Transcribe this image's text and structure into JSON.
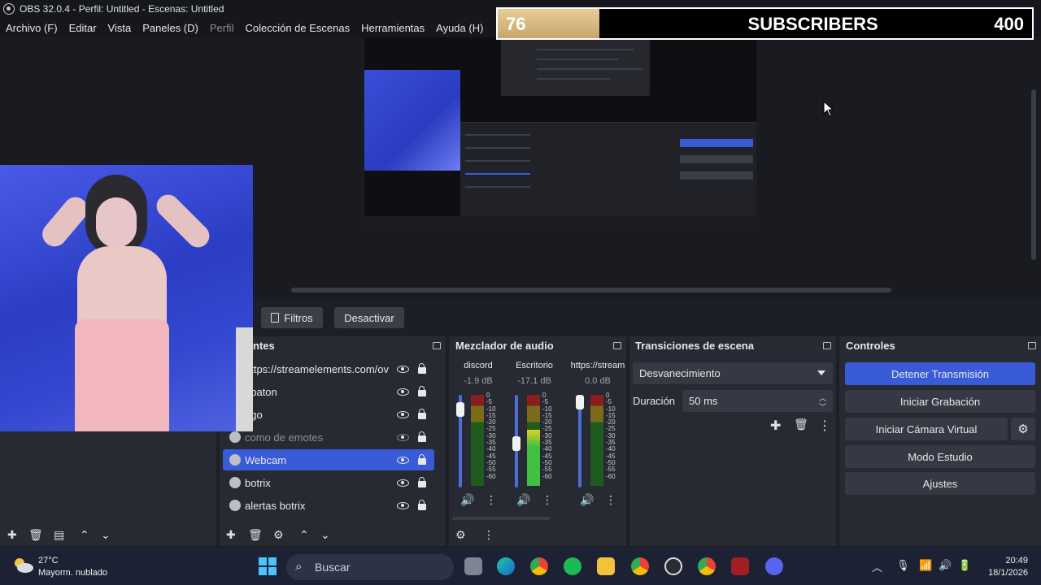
{
  "window": {
    "title": "OBS 32.0.4 - Perfil: Untitled - Escenas: Untitled"
  },
  "menu": [
    "Archivo (F)",
    "Editar",
    "Vista",
    "Paneles (D)",
    "Perfil",
    "Colección de Escenas",
    "Herramientas",
    "Ayuda (H)"
  ],
  "subscriber_goal": {
    "current": "76",
    "label": "SUBSCRIBERS",
    "goal": "400",
    "progress_fraction": 0.19
  },
  "source_toolbar": {
    "filters_label": "Filtros",
    "deactivate_label": "Desactivar"
  },
  "sources": {
    "title": "ntes",
    "items": [
      {
        "label": "https://streamelements.com/ov",
        "visible": true,
        "locked": true,
        "selected": false,
        "dim": false
      },
      {
        "label": "ubaton",
        "visible": true,
        "locked": true,
        "selected": false,
        "dim": false
      },
      {
        "label": "ego",
        "visible": true,
        "locked": true,
        "selected": false,
        "dim": false
      },
      {
        "label": "como de emotes",
        "visible": false,
        "locked": true,
        "selected": false,
        "dim": true
      },
      {
        "label": "Webcam",
        "visible": true,
        "locked": true,
        "selected": true,
        "dim": false
      },
      {
        "label": "botrix",
        "visible": true,
        "locked": true,
        "selected": false,
        "dim": false
      },
      {
        "label": "alertas botrix",
        "visible": true,
        "locked": true,
        "selected": false,
        "dim": false
      }
    ]
  },
  "mixer": {
    "title": "Mezclador de audio",
    "channels": [
      {
        "name": "discord",
        "db": "-1.9 dB",
        "fader": 0.92,
        "level": 0.0
      },
      {
        "name": "Escritorio",
        "db": "-17.1 dB",
        "fader": 0.55,
        "level": 0.62
      },
      {
        "name": "https://stream",
        "db": "0.0 dB",
        "fader": 1.0,
        "level": 0.0
      }
    ],
    "scale": [
      "0",
      "-5",
      "-10",
      "-15",
      "-20",
      "-25",
      "-30",
      "-35",
      "-40",
      "-45",
      "-50",
      "-55",
      "-60"
    ]
  },
  "transitions": {
    "title": "Transiciones de escena",
    "selected": "Desvanecimiento",
    "duration_label": "Duración",
    "duration_value": "50 ms"
  },
  "controls": {
    "title": "Controles",
    "buttons": [
      "Detener Transmisión",
      "Iniciar Grabación",
      "Iniciar Cámara Virtual",
      "Modo Estudio",
      "Ajustes"
    ]
  },
  "taskbar": {
    "weather_temp": "27°C",
    "weather_desc": "Mayorm. nublado",
    "search_placeholder": "Buscar",
    "time": "20:49",
    "date": "18/1/2026"
  },
  "colors": {
    "accent": "#3a5bd8",
    "dock_bg": "#272a33",
    "app_bg": "#1d1f26"
  }
}
